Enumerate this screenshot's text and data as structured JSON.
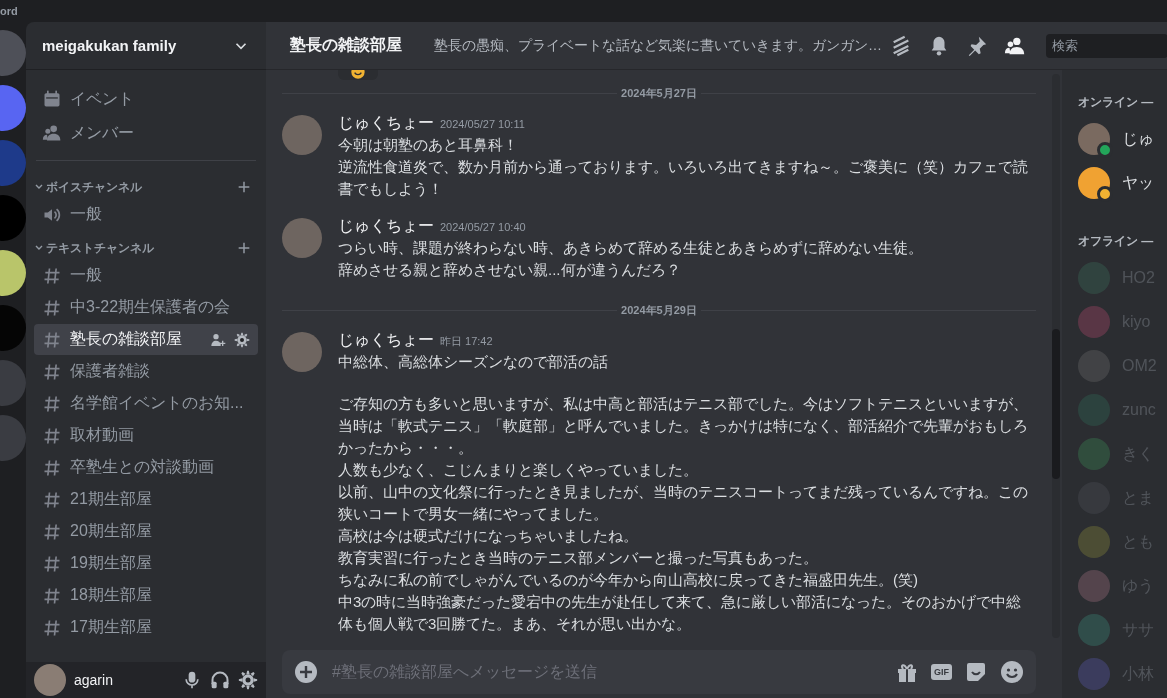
{
  "window": {
    "title": "ord"
  },
  "server": {
    "name": "meigakukan family"
  },
  "nav": [
    {
      "kind": "event",
      "label": "イベント"
    },
    {
      "kind": "members",
      "label": "メンバー"
    }
  ],
  "categories": [
    {
      "name": "ボイスチャンネル",
      "expanded": true,
      "channels": [
        {
          "kind": "voice",
          "name": "一般",
          "selected": false
        }
      ]
    },
    {
      "name": "テキストチャンネル",
      "expanded": true,
      "channels": [
        {
          "kind": "text",
          "name": "一般",
          "selected": false
        },
        {
          "kind": "text",
          "name": "中3-22期生保護者の会",
          "selected": false
        },
        {
          "kind": "text",
          "name": "塾長の雑談部屋",
          "selected": true
        },
        {
          "kind": "text",
          "name": "保護者雑談",
          "selected": false
        },
        {
          "kind": "text",
          "name": "名学館イベントのお知...",
          "selected": false
        },
        {
          "kind": "text",
          "name": "取材動画",
          "selected": false
        },
        {
          "kind": "text",
          "name": "卒塾生との対談動画",
          "selected": false
        },
        {
          "kind": "text",
          "name": "21期生部屋",
          "selected": false
        },
        {
          "kind": "text",
          "name": "20期生部屋",
          "selected": false
        },
        {
          "kind": "text",
          "name": "19期生部屋",
          "selected": false
        },
        {
          "kind": "text",
          "name": "18期生部屋",
          "selected": false
        },
        {
          "kind": "text",
          "name": "17期生部屋",
          "selected": false
        }
      ]
    }
  ],
  "user": {
    "name": "agarin"
  },
  "channel_header": {
    "name": "塾長の雑談部屋",
    "topic": "塾長の愚痴、プライベートな話など気楽に書いていきます。ガンガン…",
    "search_placeholder": "検索"
  },
  "messages": [
    {
      "kind": "divider",
      "date": "2024年5月27日"
    },
    {
      "kind": "message",
      "author": "じゅくちょー",
      "time": "2024/05/27 10:11",
      "paragraphs": [
        [
          "今朝は朝塾のあと耳鼻科！",
          "逆流性食道炎で、数か月前から通っております。いろいろ出てきますね～。ご褒美に（笑）カフェで読書でもしよう！"
        ]
      ]
    },
    {
      "kind": "message",
      "author": "じゅくちょー",
      "time": "2024/05/27 10:40",
      "paragraphs": [
        [
          "つらい時、課題が終わらない時、あきらめて辞める生徒とあきらめずに辞めない生徒。",
          "辞めさせる親と辞めさせない親...何が違うんだろ？"
        ]
      ]
    },
    {
      "kind": "divider",
      "date": "2024年5月29日"
    },
    {
      "kind": "message",
      "author": "じゅくちょー",
      "time": "昨日 17:42",
      "paragraphs": [
        [
          "中総体、高総体シーズンなので部活の話"
        ],
        [
          "ご存知の方も多いと思いますが、私は中高と部活はテニス部でした。今はソフトテニスといいますが、当時は「軟式テニス」「軟庭部」と呼んでいました。きっかけは特になく、部活紹介で先輩がおもしろかったから・・・。",
          "人数も少なく、こじんまりと楽しくやっていました。",
          "以前、山中の文化祭に行ったとき見ましたが、当時のテニスコートってまだ残っているんですね。この狭いコートで男女一緒にやってました。",
          "高校は今は硬式だけになっちゃいましたね。",
          "教育実習に行ったとき当時のテニス部メンバーと撮った写真もあった。",
          "ちなみに私の前でしゃがんでいるのが今年から向山高校に戻ってきた福盛田先生。(笑)",
          "中3の時に当時強豪だった愛宕中の先生が赴任して来て、急に厳しい部活になった。そのおかげで中総体も個人戦で3回勝てた。まあ、それが思い出かな。"
        ]
      ]
    }
  ],
  "composer": {
    "placeholder": "#塾長の雑談部屋へメッセージを送信",
    "gif_label": "GIF"
  },
  "member_groups": [
    {
      "title": "オンライン —",
      "members": [
        {
          "name": "じゅ",
          "online": true,
          "color": "#23a55a"
        },
        {
          "name": "ヤッ",
          "online": true,
          "color": "#f0b232"
        }
      ]
    },
    {
      "title": "オフライン —",
      "members": [
        {
          "name": "HO2",
          "online": false
        },
        {
          "name": "kiyo",
          "online": false
        },
        {
          "name": "OM2",
          "online": false
        },
        {
          "name": "zunc",
          "online": false
        },
        {
          "name": "きく",
          "online": false
        },
        {
          "name": "とま",
          "online": false
        },
        {
          "name": "とも",
          "online": false
        },
        {
          "name": "ゆう",
          "online": false
        },
        {
          "name": "ササ",
          "online": false
        },
        {
          "name": "小林",
          "online": false
        }
      ]
    }
  ]
}
